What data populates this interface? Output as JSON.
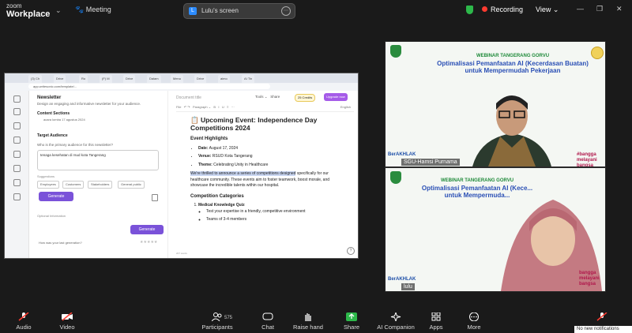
{
  "app": {
    "brand_line1": "zoom",
    "brand_line2": "Workplace",
    "meeting_label": "Meeting"
  },
  "share": {
    "avatar_letter": "L",
    "label": "Lulu's screen"
  },
  "status": {
    "recording": "Recording",
    "view": "View"
  },
  "browser": {
    "tabs": [
      "(3) Ch",
      "Drive",
      "Ro",
      "(F) M",
      "Drive",
      "Dalam",
      "Menu",
      "Drive",
      "aimo",
      "AI Tin"
    ],
    "url": "app.writesonic.com/template/..."
  },
  "left_panel": {
    "title": "Newsletter",
    "description": "Design an engaging and informative newsletter for your audience.",
    "content_sections": {
      "title": "Content Sections",
      "value": "acara lomba 17 agustus 2024"
    },
    "target_audience": {
      "title": "Target Audience",
      "question": "Who is the primary audience for this newsletter?",
      "answer": "tenaga kesehatan di rsud kota Tangerang",
      "suggestions_label": "Suggestions",
      "chips": [
        "Employees",
        "Customers",
        "Stakeholders",
        "General public"
      ]
    },
    "generate_label": "Generate",
    "optional_label": "Optional Information",
    "generate2_label": "Generate",
    "feedback_label": "How was your last generation?",
    "stars": "★★★★★"
  },
  "editor": {
    "doc_title": "Document title",
    "tools_label": "Tools",
    "share_label": "Share",
    "credits": "25 Credits",
    "upgrade_label": "Upgrade now",
    "format_label": "Paragraph",
    "language": "English",
    "heading": "\u0000Upcoming Event: Independence Day Competitions 2024",
    "highlights_title": "Event Highlights",
    "highlights": [
      {
        "k": "Date:",
        "v": "August 17, 2024"
      },
      {
        "k": "Venue:",
        "v": "RSUD Kota Tangerang"
      },
      {
        "k": "Theme:",
        "v": "Celebrating Unity in Healthcare"
      }
    ],
    "intro_highlight": "We're thrilled to announce a series of competitions designed",
    "intro_rest": "specifically for our healthcare community. These events aim to foster teamwork, boost morale, and showcase the incredible talents within our hospital.",
    "categories_title": "Competition Categories",
    "cat1": "Medical Knowledge Quiz",
    "cat1_items": [
      "Test your expertise in a friendly, competitive environment",
      "Teams of 3-4 members"
    ],
    "footer": "207 words"
  },
  "tiles": [
    {
      "title_a": "WEBINAR TANGERANG GORVU",
      "title_b": "Optimalisasi Pemanfaatan AI (Kecerdasan Buatan) untuk Mempermudah Pekerjaan",
      "name": "SGU-Hamsi Purnama",
      "bersakhlak": "BerAKHLAK",
      "brand": "#bangga melayani bangsa"
    },
    {
      "title_a": "WEBINAR TANGERANG GORVU",
      "title_b": "Optimalisasi Pemanfaatan AI (Kece... untuk Mempermuda...",
      "name": "lulu",
      "bersakhlak": "BerAKHLAK",
      "brand": "bangga melayani bangsa"
    }
  ],
  "toolbar": {
    "audio": "Audio",
    "video": "Video",
    "participants": "Participants",
    "participants_count": "575",
    "chat": "Chat",
    "raise_hand": "Raise hand",
    "share": "Share",
    "ai_companion": "AI Companion",
    "apps": "Apps",
    "more": "More",
    "notification": "No new notifications"
  },
  "colors": {
    "accent": "#7a52d9",
    "record": "#ff3b30",
    "share_green": "#2db84a",
    "tile_title": "#2a4fb5"
  }
}
